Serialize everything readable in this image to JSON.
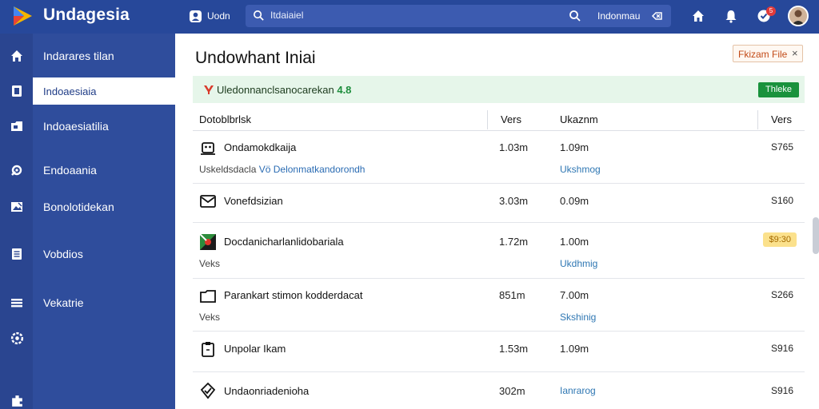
{
  "app": {
    "brand": "Undagesia",
    "account_label": "Uodn",
    "search_query": "Itdaiaiel",
    "search_location": "Indonmau",
    "notification_count": "5"
  },
  "sidebar": {
    "items": [
      {
        "label": "Indarares tilan",
        "icon": "home-icon"
      },
      {
        "label": "Indoaesiaia",
        "icon": "document-icon",
        "active": true
      },
      {
        "label": "Indoaesiatilia",
        "icon": "folder-icon"
      },
      {
        "label": "Endoaania",
        "icon": "tools-icon"
      },
      {
        "label": "Bonolotidekan",
        "icon": "image-icon"
      },
      {
        "label": "Vobdios",
        "icon": "list-icon"
      },
      {
        "label": "Vekatrie",
        "icon": "menu-icon"
      }
    ],
    "extra_icons": [
      "settings-icon",
      "puzzle-icon"
    ]
  },
  "main": {
    "title": "Undowhant Iniai",
    "export_label": "Fkizam File",
    "export_close": "×",
    "banner": {
      "text": "Uledonnanclsanocarekan",
      "link": "4.8",
      "button": "Thleke"
    },
    "columns": {
      "name": "Dotoblbrlsk",
      "version": "Vers",
      "updated": "Ukaznm",
      "size": "Vers"
    },
    "rows": [
      {
        "name": "Ondamokdkaija",
        "sub": "Uskeldsdacla",
        "sub_link": "Vö Delonmatkandorondh",
        "version": "1.03m",
        "updated": "1.09m",
        "status": "Ukshmog",
        "size": "S765",
        "icon": "robot-icon"
      },
      {
        "name": "Vonefdsizian",
        "sub": "",
        "sub_link": "",
        "version": "3.03m",
        "updated": "0.09m",
        "status": "",
        "size": "S160",
        "icon": "mail-icon"
      },
      {
        "name": "Docdanicharlanlidobariala",
        "sub": "Veks",
        "sub_link": "",
        "version": "1.72m",
        "updated": "1.00m",
        "status": "Ukdhmig",
        "size": "",
        "badge": "$9:30",
        "icon": "flag-icon"
      },
      {
        "name": "Parankart stimon kodderdacat",
        "sub": "Veks",
        "sub_link": "",
        "version": "851m",
        "updated": "7.00m",
        "status": "Skshinig",
        "size": "S266",
        "icon": "folder-icon"
      },
      {
        "name": "Unpolar Ikam",
        "sub": "",
        "sub_link": "",
        "version": "1.53m",
        "updated": "1.09m",
        "status": "",
        "size": "S916",
        "icon": "clipboard-icon"
      },
      {
        "name": "Undaonriadenioha",
        "sub": "",
        "sub_link": "",
        "version": "302m",
        "updated": "",
        "status": "Ianrarog",
        "size": "S916",
        "icon": "check-icon"
      }
    ]
  },
  "colors": {
    "topbar": "#27489a",
    "sidebar": "#2f4d9c",
    "banner_bg": "#e6f6ea",
    "accent_green": "#19923c",
    "link_blue": "#2b6cb3"
  }
}
